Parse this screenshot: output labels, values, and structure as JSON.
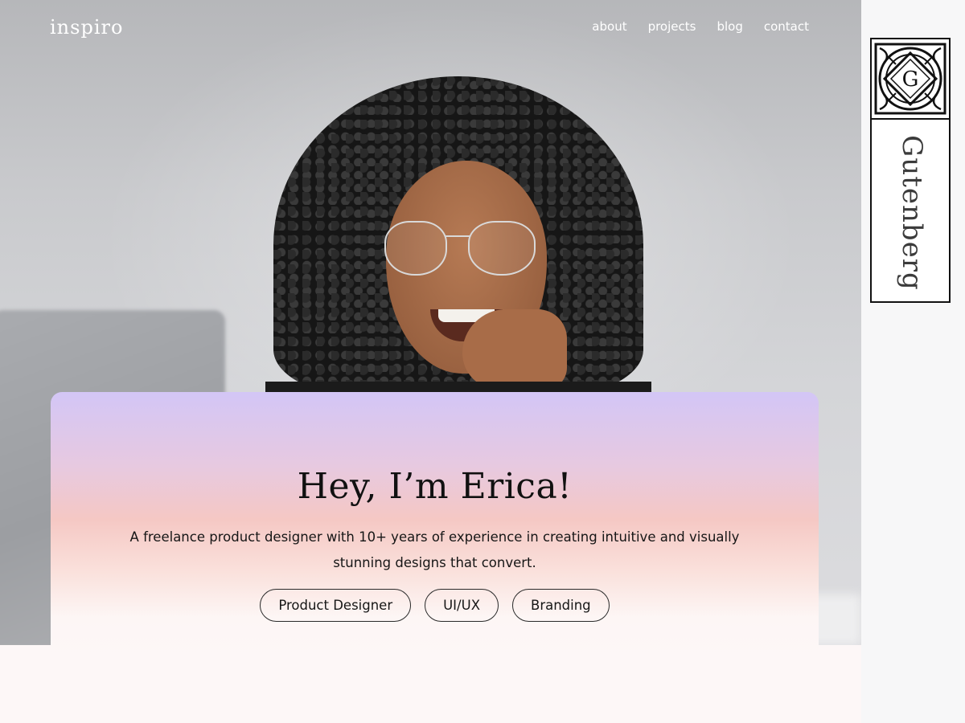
{
  "brand": {
    "name": "inspiro"
  },
  "nav": {
    "items": [
      {
        "label": "about"
      },
      {
        "label": "projects"
      },
      {
        "label": "blog"
      },
      {
        "label": "contact"
      }
    ]
  },
  "hero": {
    "heading": "Hey, I’m Erica!",
    "intro": "A freelance product designer with 10+ years of experience in creating intuitive and visually stunning designs that convert.",
    "tags": [
      {
        "label": "Product Designer"
      },
      {
        "label": "UI/UX"
      },
      {
        "label": "Branding"
      }
    ]
  },
  "badge": {
    "word": "Gutenberg",
    "logo_icon": "gutenberg-g-logo-icon"
  },
  "colors": {
    "nav_text": "#ffffff",
    "card_gradient_top": "#d3c6f6",
    "card_gradient_mid": "#f5c8c4",
    "card_gradient_bottom": "#fdf7f7",
    "text_dark": "#161616"
  }
}
